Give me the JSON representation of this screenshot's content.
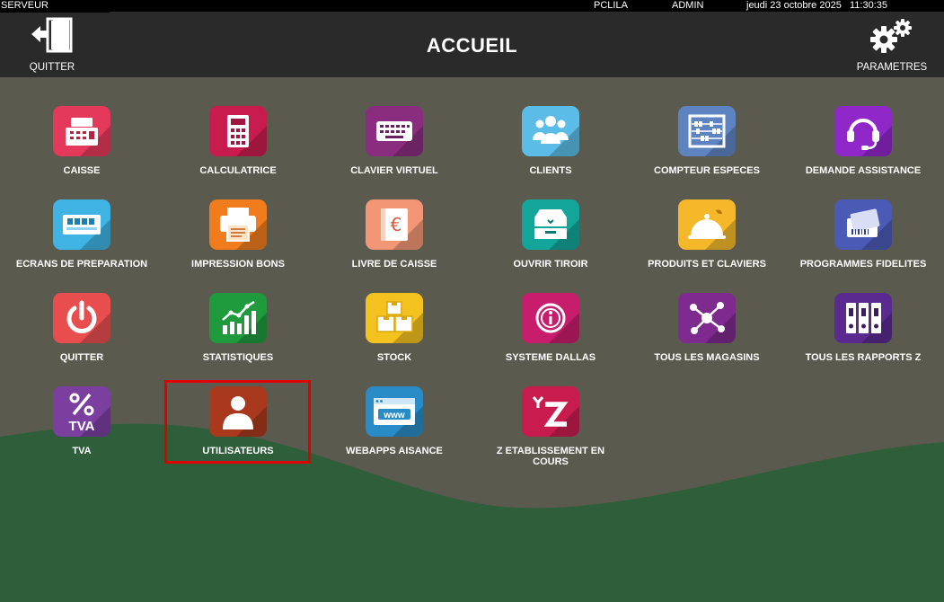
{
  "status": {
    "server": "SERVEUR",
    "terminal": "PCLILA",
    "user": "ADMIN",
    "datetime": "jeudi 23 octobre 2025   11:30:35"
  },
  "header": {
    "title": "ACCUEIL",
    "quit_label": "QUITTER",
    "settings_label": "PARAMETRES"
  },
  "tiles": [
    {
      "label": "CAISSE",
      "icon": "cash-register-icon",
      "color": "#e5395c"
    },
    {
      "label": "CALCULATRICE",
      "icon": "calculator-icon",
      "color": "#c81c4e"
    },
    {
      "label": "CLAVIER VIRTUEL",
      "icon": "keyboard-icon",
      "color": "#8b2d7f"
    },
    {
      "label": "CLIENTS",
      "icon": "people-icon",
      "color": "#5bbde7"
    },
    {
      "label": "COMPTEUR ESPECES",
      "icon": "abacus-icon",
      "color": "#5d84c1"
    },
    {
      "label": "DEMANDE ASSISTANCE",
      "icon": "headset-icon",
      "color": "#8f27c9"
    },
    {
      "label": "ECRANS DE PREPARATION",
      "icon": "display-icon",
      "color": "#3fb3e4"
    },
    {
      "label": "IMPRESSION BONS",
      "icon": "printer-icon",
      "color": "#f07c1e"
    },
    {
      "label": "LIVRE DE CAISSE",
      "icon": "cash-book-icon",
      "color": "#f29675"
    },
    {
      "label": "OUVRIR TIROIR",
      "icon": "drawer-icon",
      "color": "#13a59a"
    },
    {
      "label": "PRODUITS ET CLAVIERS",
      "icon": "food-icon",
      "color": "#f5b82b"
    },
    {
      "label": "PROGRAMMES FIDELITES",
      "icon": "loyalty-card-icon",
      "color": "#4a5ab5"
    },
    {
      "label": "QUITTER",
      "icon": "power-icon",
      "color": "#e84e4e"
    },
    {
      "label": "STATISTIQUES",
      "icon": "chart-icon",
      "color": "#1f9a3c"
    },
    {
      "label": "STOCK",
      "icon": "boxes-icon",
      "color": "#f4c21f"
    },
    {
      "label": "SYSTEME DALLAS",
      "icon": "dallas-key-icon",
      "color": "#c71d6c"
    },
    {
      "label": "TOUS LES MAGASINS",
      "icon": "network-icon",
      "color": "#7e2a8e"
    },
    {
      "label": "TOUS LES RAPPORTS Z",
      "icon": "binders-icon",
      "color": "#5a2a90"
    },
    {
      "label": "TVA",
      "icon": "percent-icon",
      "color": "#7b3fa0",
      "text": "TVA"
    },
    {
      "label": "UTILISATEURS",
      "icon": "user-icon",
      "color": "#a8391d"
    },
    {
      "label": "WEBAPPS AISANCE",
      "icon": "web-window-icon",
      "color": "#2a8cc6",
      "text": "www"
    },
    {
      "label": "Z ETABLISSEMENT EN COURS",
      "icon": "z-report-icon",
      "color": "#c81c4e",
      "text": "Z"
    }
  ],
  "selected_tile": "UTILISATEURS",
  "colors": {
    "background": "#5b5a4f",
    "hill": "#2f5e3a",
    "header": "#2a2a2a",
    "highlight": "#e00000"
  }
}
